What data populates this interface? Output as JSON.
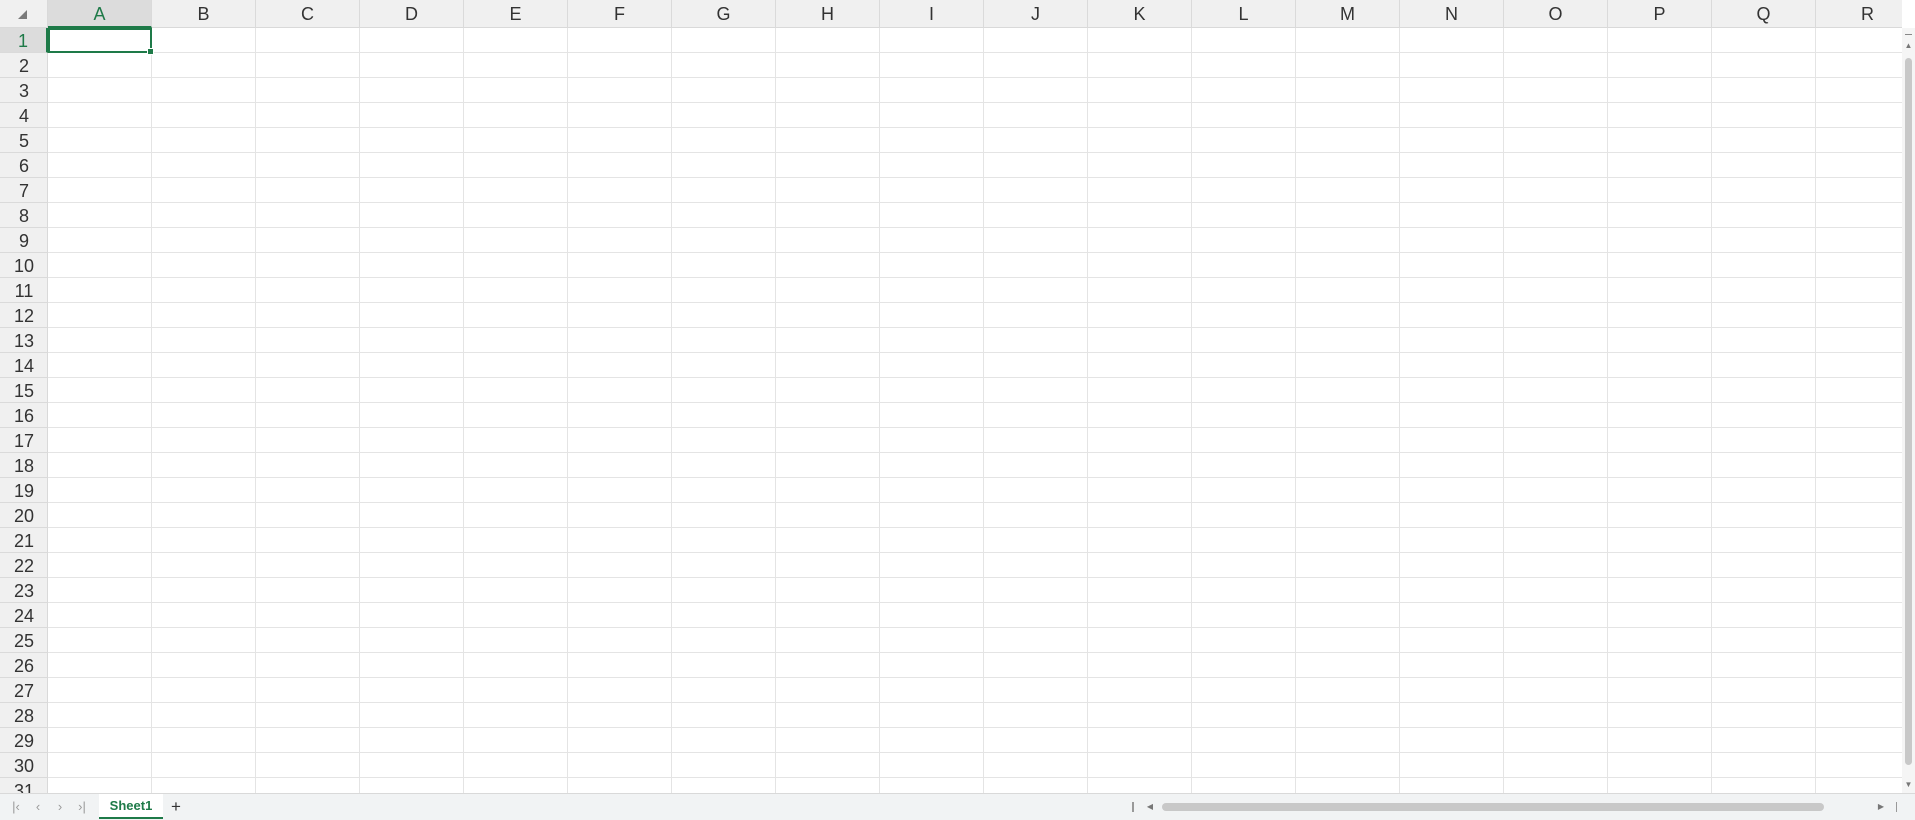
{
  "spreadsheet": {
    "columns": [
      "A",
      "B",
      "C",
      "D",
      "E",
      "F",
      "G",
      "H",
      "I",
      "J",
      "K",
      "L",
      "M",
      "N",
      "O",
      "P",
      "Q",
      "R"
    ],
    "rows": [
      "1",
      "2",
      "3",
      "4",
      "5",
      "6",
      "7",
      "8",
      "9",
      "10",
      "11",
      "12",
      "13",
      "14",
      "15",
      "16",
      "17",
      "18",
      "19",
      "20",
      "21",
      "22",
      "23",
      "24",
      "25",
      "26",
      "27",
      "28",
      "29",
      "30",
      "31"
    ],
    "active_column": "A",
    "active_row": "1",
    "accent_color": "#1e7a48"
  },
  "sheet_tabs": {
    "nav_icons": [
      "first-sheet-icon",
      "prev-sheet-icon",
      "next-sheet-icon",
      "last-sheet-icon"
    ],
    "tabs": [
      "Sheet1"
    ],
    "active_tab": "Sheet1",
    "add_label": "+"
  }
}
